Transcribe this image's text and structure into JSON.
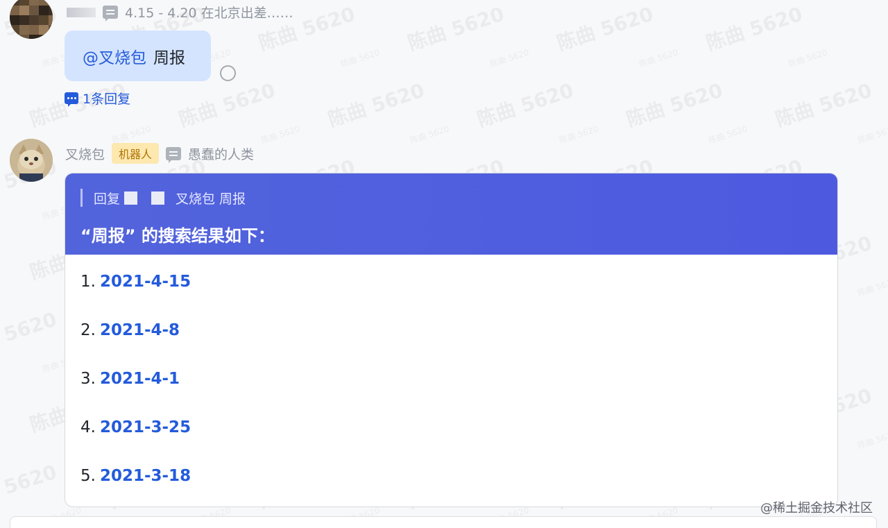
{
  "watermark_text": "陈曲 5620",
  "message1": {
    "sender_meta": "4.15 - 4.20 在北京出差……",
    "mention": "@叉烧包",
    "text": "周报",
    "reply_count_label": "1条回复"
  },
  "message2": {
    "sender_name": "叉烧包",
    "badge": "机器人",
    "signature": "愚蠢的人类",
    "card": {
      "reply_prefix": "回复",
      "reply_target": "叉烧包 周报",
      "title": "“周报” 的搜索结果如下：",
      "results": [
        {
          "num": "1.",
          "label": "2021-4-15"
        },
        {
          "num": "2.",
          "label": "2021-4-8"
        },
        {
          "num": "3.",
          "label": "2021-4-1"
        },
        {
          "num": "4.",
          "label": "2021-3-25"
        },
        {
          "num": "5.",
          "label": "2021-3-18"
        }
      ]
    }
  },
  "credit": "@稀土掘金技术社区",
  "colors": {
    "card_header": "#5264dc",
    "link": "#245bdb",
    "bubble": "#d4e4ff",
    "badge_bg": "#fde8b0"
  }
}
